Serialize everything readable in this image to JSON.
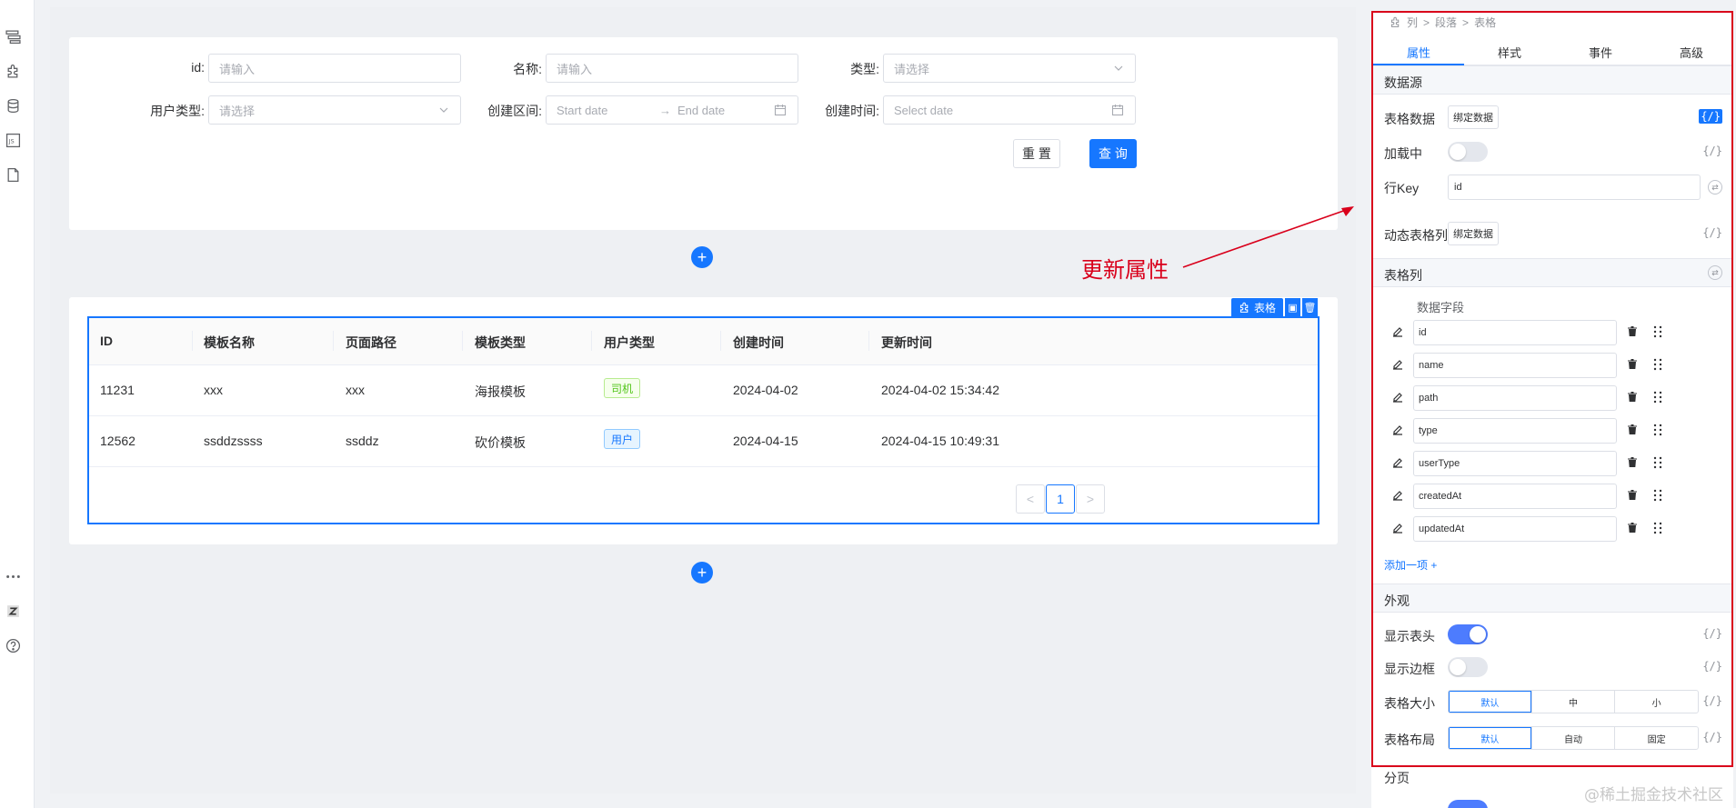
{
  "form": {
    "id_label": "id:",
    "id_placeholder": "请输入",
    "name_label": "名称:",
    "name_placeholder": "请输入",
    "type_label": "类型:",
    "type_placeholder": "请选择",
    "usertype_label": "用户类型:",
    "usertype_placeholder": "请选择",
    "range_label": "创建区间:",
    "range_start": "Start date",
    "range_sep": "→",
    "range_end": "End date",
    "created_label": "创建时间:",
    "created_placeholder": "Select date",
    "reset_label": "重 置",
    "query_label": "查 询"
  },
  "table": {
    "tag_label": "表格",
    "columns": [
      "ID",
      "模板名称",
      "页面路径",
      "模板类型",
      "用户类型",
      "创建时间",
      "更新时间"
    ],
    "rows": [
      {
        "id": "11231",
        "name": "xxx",
        "path": "xxx",
        "type": "海报模板",
        "user_type": "司机",
        "created": "2024-04-02",
        "updated": "2024-04-02 15:34:42"
      },
      {
        "id": "12562",
        "name": "ssddzssss",
        "path": "ssddz",
        "type": "砍价模板",
        "user_type": "用户",
        "created": "2024-04-15",
        "updated": "2024-04-15 10:49:31"
      }
    ],
    "pager": {
      "prev": "<",
      "current": "1",
      "next": ">"
    }
  },
  "annotation": "更新属性",
  "panel": {
    "breadcrumb": [
      "列",
      ">",
      "段落",
      ">",
      "表格"
    ],
    "tabs": [
      "属性",
      "样式",
      "事件",
      "高级"
    ],
    "datasource": {
      "title": "数据源",
      "table_data_label": "表格数据",
      "bind_label": "绑定数据",
      "loading_label": "加载中",
      "rowkey_label": "行Key",
      "rowkey_value": "id",
      "dynamic_cols_label": "动态表格列",
      "fx": "{/}"
    },
    "columns_section": {
      "title": "表格列",
      "field_header": "数据字段",
      "fields": [
        "id",
        "name",
        "path",
        "type",
        "userType",
        "createdAt",
        "updatedAt"
      ],
      "add_label": "添加一项 +"
    },
    "appearance": {
      "title": "外观",
      "show_header_label": "显示表头",
      "show_border_label": "显示边框",
      "size_label": "表格大小",
      "size_options": [
        "默认",
        "中",
        "小"
      ],
      "layout_label": "表格布局",
      "layout_options": [
        "默认",
        "自动",
        "固定"
      ]
    },
    "pagination_title": "分页"
  },
  "watermark": "@稀土掘金技术社区",
  "colors": {
    "primary": "#1677ff",
    "annotation": "#d9001b"
  }
}
